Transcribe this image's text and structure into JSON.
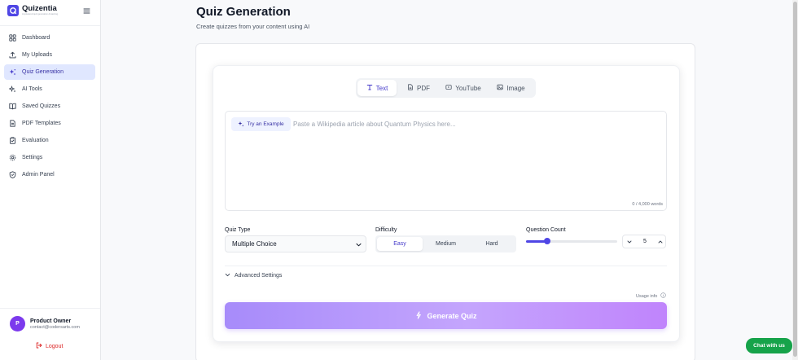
{
  "brand": {
    "name": "Quizentia",
    "tagline": "AI-powered quiz generation & learning"
  },
  "sidebar": {
    "items": [
      {
        "label": "Dashboard",
        "icon": "grid-icon",
        "active": false
      },
      {
        "label": "My Uploads",
        "icon": "upload-icon",
        "active": false
      },
      {
        "label": "Quiz Generation",
        "icon": "sparkles-icon",
        "active": true
      },
      {
        "label": "AI Tools",
        "icon": "sparkles-icon",
        "active": false
      },
      {
        "label": "Saved Quizzes",
        "icon": "book-icon",
        "active": false
      },
      {
        "label": "PDF Templates",
        "icon": "file-text-icon",
        "active": false
      },
      {
        "label": "Evaluation",
        "icon": "clipboard-check-icon",
        "active": false
      },
      {
        "label": "Settings",
        "icon": "gear-icon",
        "active": false
      },
      {
        "label": "Admin Panel",
        "icon": "shield-icon",
        "active": false
      }
    ],
    "user": {
      "initial": "P",
      "name": "Product Owner",
      "email": "contact@codersarts.com"
    },
    "logout_label": "Logout"
  },
  "header": {
    "title": "Quiz Generation",
    "subtitle": "Create quizzes from your content using AI"
  },
  "tabs": [
    {
      "label": "Text",
      "icon": "text-icon",
      "active": true
    },
    {
      "label": "PDF",
      "icon": "file-icon",
      "active": false
    },
    {
      "label": "YouTube",
      "icon": "video-icon",
      "active": false
    },
    {
      "label": "Image",
      "icon": "image-icon",
      "active": false
    }
  ],
  "editor": {
    "example_label": "Try an Example",
    "placeholder": "Paste a Wikipedia article about Quantum Physics here...",
    "word_count": "0 / 4,000 words"
  },
  "options": {
    "quiz_type_label": "Quiz Type",
    "quiz_type_value": "Multiple Choice",
    "difficulty_label": "Difficulty",
    "difficulty_levels": [
      "Easy",
      "Medium",
      "Hard"
    ],
    "difficulty_selected": "Easy",
    "question_count_label": "Question Count",
    "question_count_value": "5",
    "slider_fraction": 0.23
  },
  "advanced_label": "Advanced Settings",
  "usage_label": "Usage info",
  "generate_label": "Generate Quiz",
  "chat_label": "Chat with us",
  "colors": {
    "accent": "#4f46e5",
    "active_bg": "#e0e7ff",
    "generate_start": "#a78bfa",
    "generate_end": "#c084fc",
    "chat": "#16a34a",
    "logout": "#dc2626"
  }
}
